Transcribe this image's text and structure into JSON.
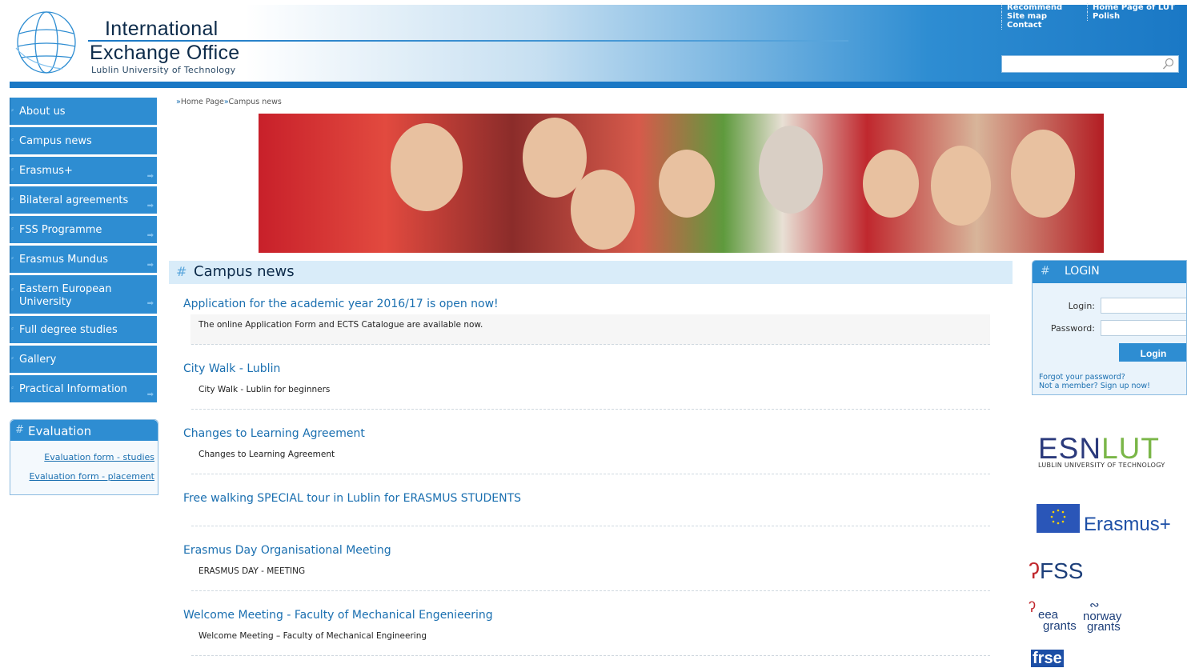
{
  "header": {
    "title_line1": "International",
    "title_line2": "Exchange Office",
    "subtitle": "Lublin University of Technology",
    "links_col1": [
      "Recommend",
      "Site map",
      "Contact"
    ],
    "links_col2": [
      "Home Page of LUT",
      "Polish"
    ],
    "search": {
      "value": "",
      "placeholder": ""
    }
  },
  "sidebar": {
    "items": [
      {
        "label": "About us",
        "has_arrow": false
      },
      {
        "label": "Campus news",
        "has_arrow": false
      },
      {
        "label": "Erasmus+",
        "has_arrow": true
      },
      {
        "label": "Bilateral agreements",
        "has_arrow": true
      },
      {
        "label": "FSS Programme",
        "has_arrow": true
      },
      {
        "label": "Erasmus Mundus",
        "has_arrow": true
      },
      {
        "label": "Eastern European University",
        "has_arrow": true
      },
      {
        "label": "Full degree studies",
        "has_arrow": false
      },
      {
        "label": "Gallery",
        "has_arrow": false
      },
      {
        "label": "Practical Information",
        "has_arrow": true
      }
    ],
    "evaluation": {
      "title": "Evaluation",
      "links": [
        "Evaluation form - studies",
        "Evaluation form - placement"
      ]
    }
  },
  "breadcrumb": [
    "Home Page",
    "Campus news"
  ],
  "main": {
    "section_title": "Campus news",
    "news": [
      {
        "title": "Application for the academic year 2016/17 is open now!",
        "desc": "The online Application Form and ECTS Catalogue are available now."
      },
      {
        "title": "City Walk - Lublin",
        "desc": "City Walk - Lublin for beginners"
      },
      {
        "title": "Changes to Learning Agreement",
        "desc": "Changes to Learning Agreement"
      },
      {
        "title": "Free walking SPECIAL tour in Lublin for ERASMUS STUDENTS",
        "desc": ""
      },
      {
        "title": "Erasmus Day Organisational Meeting",
        "desc": "ERASMUS DAY - MEETING"
      },
      {
        "title": "Welcome Meeting - Faculty of Mechanical Engenieering",
        "desc": "Welcome Meeting – Faculty of Mechanical Engineering"
      }
    ]
  },
  "login": {
    "title": "LOGIN",
    "login_label": "Login:",
    "password_label": "Password:",
    "button": "Login",
    "forgot": "Forgot your password?",
    "signup": "Not a member? Sign up now!"
  },
  "partners": {
    "esn_main": "ESN",
    "esn_lut": "LUT",
    "esn_sub": "LUBLIN UNIVERSITY OF TECHNOLOGY",
    "erasmus": "Erasmus+",
    "fss": "FSS",
    "eea_1": "eea",
    "eea_2": "grants",
    "norway_1": "norway",
    "norway_2": "grants",
    "frse": "frse"
  },
  "colors": {
    "nav_blue": "#2e8dd2",
    "link_blue": "#1a6fb0",
    "header_dark": "#1a78c5"
  }
}
